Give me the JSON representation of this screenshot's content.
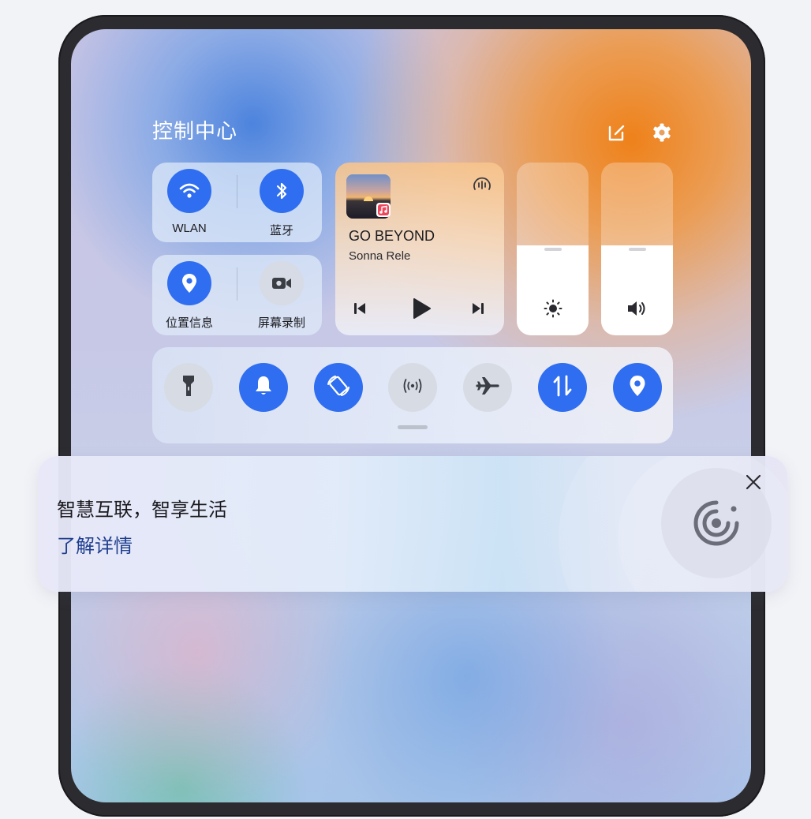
{
  "control_center": {
    "title": "控制中心",
    "edit_icon": "edit-icon",
    "settings_icon": "gear-icon"
  },
  "connectivity": {
    "wlan": {
      "label": "WLAN",
      "icon": "wifi-icon",
      "active": true
    },
    "bluetooth": {
      "label": "蓝牙",
      "icon": "bluetooth-icon",
      "active": true
    },
    "location": {
      "label": "位置信息",
      "icon": "location-pin-icon",
      "active": true
    },
    "screen_record": {
      "label": "屏幕录制",
      "icon": "video-camera-icon",
      "active": false
    }
  },
  "music": {
    "song_title": "GO BEYOND",
    "artist": "Sonna Rele",
    "album_badge": "music-note-icon",
    "audio_output_icon": "audio-output-icon",
    "controls": [
      "previous-icon",
      "play-icon",
      "next-icon"
    ]
  },
  "sliders": {
    "brightness": {
      "icon": "sun-icon",
      "level": 0.52
    },
    "volume": {
      "icon": "speaker-icon",
      "level": 0.52
    }
  },
  "quick_toggles": [
    {
      "name": "flashlight",
      "icon": "flashlight-icon",
      "active": false
    },
    {
      "name": "notification-bell",
      "icon": "bell-icon",
      "active": true
    },
    {
      "name": "auto-rotate",
      "icon": "rotate-icon",
      "active": true
    },
    {
      "name": "nfc",
      "icon": "nfc-icon",
      "active": false
    },
    {
      "name": "airplane-mode",
      "icon": "airplane-icon",
      "active": false
    },
    {
      "name": "mobile-data",
      "icon": "mobile-data-icon",
      "active": true
    },
    {
      "name": "location",
      "icon": "location-pin-icon",
      "active": true
    }
  ],
  "banner": {
    "headline": "智慧互联，智享生活",
    "link": "了解详情",
    "close_icon": "close-icon",
    "illustration_icon": "super-device-icon"
  },
  "colors": {
    "accent_blue": "#2f6ef0",
    "link_blue": "#1f3f8f",
    "orange_glow": "#ef8016"
  }
}
